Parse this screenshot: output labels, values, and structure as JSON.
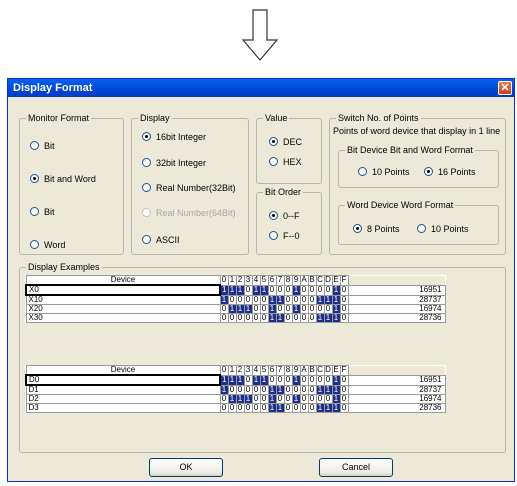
{
  "dialog": {
    "title": "Display Format",
    "ok_label": "OK",
    "cancel_label": "Cancel"
  },
  "monitor_format": {
    "legend": "Monitor Format",
    "options": [
      "Bit",
      "Bit and Word",
      "Bit",
      "Word"
    ],
    "selected": 1
  },
  "display": {
    "legend": "Display",
    "options": [
      "16bit Integer",
      "32bit Integer",
      "Real Number(32Bit)",
      "Real Number(64Bit)",
      "ASCII"
    ],
    "selected": 0,
    "disabled": [
      3
    ]
  },
  "value": {
    "legend": "Value",
    "options": [
      "DEC",
      "HEX"
    ],
    "selected": 0
  },
  "bit_order": {
    "legend": "Bit Order",
    "options": [
      "0--F",
      "F--0"
    ],
    "selected": 0
  },
  "switch_points": {
    "legend": "Switch No. of Points",
    "description": "Points of word device that display in 1 line",
    "bit_device": {
      "legend": "Bit Device  Bit and Word Format",
      "options": [
        "10 Points",
        "16 Points"
      ],
      "selected": 1
    },
    "word_device": {
      "legend": "Word Device  Word Format",
      "options": [
        "8 Points",
        "10 Points"
      ],
      "selected": 0
    }
  },
  "examples": {
    "legend": "Display Examples",
    "device_header": "Device",
    "bit_headers": [
      "0",
      "1",
      "2",
      "3",
      "4",
      "5",
      "6",
      "7",
      "8",
      "9",
      "A",
      "B",
      "C",
      "D",
      "E",
      "F"
    ],
    "tables": [
      {
        "rows": [
          {
            "device": "X0",
            "bits": "1110110001000010",
            "value": "16951"
          },
          {
            "device": "X10",
            "bits": "1000001100001110",
            "value": "28737"
          },
          {
            "device": "X20",
            "bits": "0111001001000010",
            "value": "16974"
          },
          {
            "device": "X30",
            "bits": "0000001100001110",
            "value": "28736"
          }
        ]
      },
      {
        "rows": [
          {
            "device": "D0",
            "bits": "1110110001000010",
            "value": "16951"
          },
          {
            "device": "D1",
            "bits": "1000001100001110",
            "value": "28737"
          },
          {
            "device": "D2",
            "bits": "0111001001000010",
            "value": "16974"
          },
          {
            "device": "D3",
            "bits": "0000001100001110",
            "value": "28736"
          }
        ]
      }
    ]
  }
}
